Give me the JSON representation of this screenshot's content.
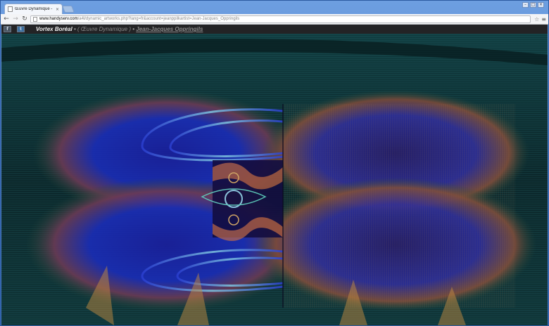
{
  "browser": {
    "tab_title": "Œuvre Dynamique - Projets",
    "tab_close": "×",
    "url_host": "www.handyserv.com",
    "url_path": "/a4l/dynamic_artworks.php?lang=fr&account=jeanppilkartist=Jean-Jacques_Oppringils",
    "icons": {
      "back": "back-arrow-icon",
      "forward": "forward-arrow-icon",
      "reload": "reload-icon",
      "page": "page-icon",
      "star": "star-icon",
      "menu": "menu-icon"
    }
  },
  "window_controls": {
    "minimize": "–",
    "maximize": "□",
    "close": "×"
  },
  "site": {
    "facebook": "f",
    "twitter": "t",
    "title": "Vortex Boréal",
    "sep1": " • ",
    "kind": "( Œuvre Dynamique )",
    "sep2": " • ",
    "artist": "Jean-Jacques Oppringils"
  },
  "colors": {
    "tab_strip": "#4a7fc9",
    "site_bar": "#232325",
    "art_background": "#0b2c2f"
  }
}
